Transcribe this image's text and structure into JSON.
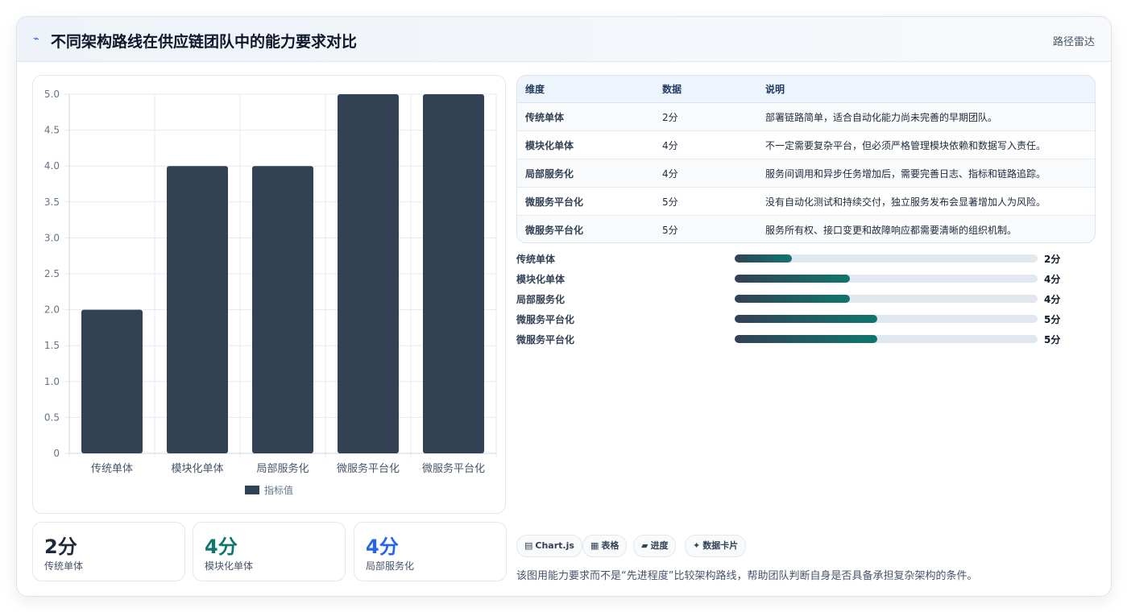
{
  "header": {
    "logo_icon": "lightning-icon",
    "title": "不同架构路线在供应链团队中的能力要求对比",
    "tag": "路径雷达"
  },
  "chart_data": {
    "type": "bar",
    "categories": [
      "传统单体",
      "模块化单体",
      "局部服务化",
      "微服务平台化",
      "微服务平台化"
    ],
    "series": [
      {
        "name": "指标值",
        "values": [
          2,
          4,
          4,
          5,
          5
        ],
        "color": "#334155"
      }
    ],
    "ylim": [
      0,
      5
    ],
    "yticks": [
      "0",
      "0.5",
      "1.0",
      "1.5",
      "2.0",
      "2.5",
      "3.0",
      "3.5",
      "4.0",
      "4.5",
      "5.0"
    ],
    "legend": "bottom",
    "grid": true
  },
  "stats": [
    {
      "value": "2分",
      "label": "传统单体",
      "color": "#1e293b"
    },
    {
      "value": "4分",
      "label": "模块化单体",
      "color": "#0f766e"
    },
    {
      "value": "4分",
      "label": "局部服务化",
      "color": "#2563eb"
    }
  ],
  "table": {
    "headers": [
      "维度",
      "数据",
      "说明"
    ],
    "rows": [
      [
        "传统单体",
        "2分",
        "部署链路简单，适合自动化能力尚未完善的早期团队。"
      ],
      [
        "模块化单体",
        "4分",
        "不一定需要复杂平台，但必须严格管理模块依赖和数据写入责任。"
      ],
      [
        "局部服务化",
        "4分",
        "服务间调用和异步任务增加后，需要完善日志、指标和链路追踪。"
      ],
      [
        "微服务平台化",
        "5分",
        "没有自动化测试和持续交付，独立服务发布会显著增加人为风险。"
      ],
      [
        "微服务平台化",
        "5分",
        "服务所有权、接口变更和故障响应都需要清晰的组织机制。"
      ]
    ]
  },
  "progress": [
    {
      "label": "传统单体",
      "value": "2分",
      "fraction": 0.19
    },
    {
      "label": "模块化单体",
      "value": "4分",
      "fraction": 0.38
    },
    {
      "label": "局部服务化",
      "value": "4分",
      "fraction": 0.38
    },
    {
      "label": "微服务平台化",
      "value": "5分",
      "fraction": 0.47
    },
    {
      "label": "微服务平台化",
      "value": "5分",
      "fraction": 0.47
    }
  ],
  "chips": [
    {
      "icon": "chart-icon",
      "glyph": "▤",
      "label": "Chart.js"
    },
    {
      "icon": "table-icon",
      "glyph": "▦",
      "label": "表格"
    },
    {
      "icon": "progress-icon",
      "glyph": "▰",
      "label": "进度"
    },
    {
      "icon": "card-icon",
      "glyph": "✦",
      "label": "数据卡片"
    }
  ],
  "note": "该图用能力要求而不是“先进程度”比较架构路线，帮助团队判断自身是否具备承担复杂架构的条件。"
}
